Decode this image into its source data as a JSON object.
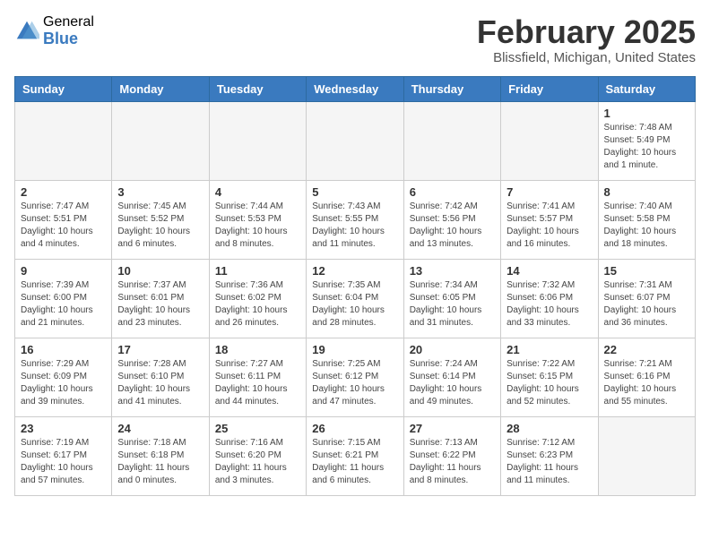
{
  "header": {
    "logo_general": "General",
    "logo_blue": "Blue",
    "month_year": "February 2025",
    "location": "Blissfield, Michigan, United States"
  },
  "days_of_week": [
    "Sunday",
    "Monday",
    "Tuesday",
    "Wednesday",
    "Thursday",
    "Friday",
    "Saturday"
  ],
  "weeks": [
    [
      {
        "day": "",
        "info": ""
      },
      {
        "day": "",
        "info": ""
      },
      {
        "day": "",
        "info": ""
      },
      {
        "day": "",
        "info": ""
      },
      {
        "day": "",
        "info": ""
      },
      {
        "day": "",
        "info": ""
      },
      {
        "day": "1",
        "info": "Sunrise: 7:48 AM\nSunset: 5:49 PM\nDaylight: 10 hours\nand 1 minute."
      }
    ],
    [
      {
        "day": "2",
        "info": "Sunrise: 7:47 AM\nSunset: 5:51 PM\nDaylight: 10 hours\nand 4 minutes."
      },
      {
        "day": "3",
        "info": "Sunrise: 7:45 AM\nSunset: 5:52 PM\nDaylight: 10 hours\nand 6 minutes."
      },
      {
        "day": "4",
        "info": "Sunrise: 7:44 AM\nSunset: 5:53 PM\nDaylight: 10 hours\nand 8 minutes."
      },
      {
        "day": "5",
        "info": "Sunrise: 7:43 AM\nSunset: 5:55 PM\nDaylight: 10 hours\nand 11 minutes."
      },
      {
        "day": "6",
        "info": "Sunrise: 7:42 AM\nSunset: 5:56 PM\nDaylight: 10 hours\nand 13 minutes."
      },
      {
        "day": "7",
        "info": "Sunrise: 7:41 AM\nSunset: 5:57 PM\nDaylight: 10 hours\nand 16 minutes."
      },
      {
        "day": "8",
        "info": "Sunrise: 7:40 AM\nSunset: 5:58 PM\nDaylight: 10 hours\nand 18 minutes."
      }
    ],
    [
      {
        "day": "9",
        "info": "Sunrise: 7:39 AM\nSunset: 6:00 PM\nDaylight: 10 hours\nand 21 minutes."
      },
      {
        "day": "10",
        "info": "Sunrise: 7:37 AM\nSunset: 6:01 PM\nDaylight: 10 hours\nand 23 minutes."
      },
      {
        "day": "11",
        "info": "Sunrise: 7:36 AM\nSunset: 6:02 PM\nDaylight: 10 hours\nand 26 minutes."
      },
      {
        "day": "12",
        "info": "Sunrise: 7:35 AM\nSunset: 6:04 PM\nDaylight: 10 hours\nand 28 minutes."
      },
      {
        "day": "13",
        "info": "Sunrise: 7:34 AM\nSunset: 6:05 PM\nDaylight: 10 hours\nand 31 minutes."
      },
      {
        "day": "14",
        "info": "Sunrise: 7:32 AM\nSunset: 6:06 PM\nDaylight: 10 hours\nand 33 minutes."
      },
      {
        "day": "15",
        "info": "Sunrise: 7:31 AM\nSunset: 6:07 PM\nDaylight: 10 hours\nand 36 minutes."
      }
    ],
    [
      {
        "day": "16",
        "info": "Sunrise: 7:29 AM\nSunset: 6:09 PM\nDaylight: 10 hours\nand 39 minutes."
      },
      {
        "day": "17",
        "info": "Sunrise: 7:28 AM\nSunset: 6:10 PM\nDaylight: 10 hours\nand 41 minutes."
      },
      {
        "day": "18",
        "info": "Sunrise: 7:27 AM\nSunset: 6:11 PM\nDaylight: 10 hours\nand 44 minutes."
      },
      {
        "day": "19",
        "info": "Sunrise: 7:25 AM\nSunset: 6:12 PM\nDaylight: 10 hours\nand 47 minutes."
      },
      {
        "day": "20",
        "info": "Sunrise: 7:24 AM\nSunset: 6:14 PM\nDaylight: 10 hours\nand 49 minutes."
      },
      {
        "day": "21",
        "info": "Sunrise: 7:22 AM\nSunset: 6:15 PM\nDaylight: 10 hours\nand 52 minutes."
      },
      {
        "day": "22",
        "info": "Sunrise: 7:21 AM\nSunset: 6:16 PM\nDaylight: 10 hours\nand 55 minutes."
      }
    ],
    [
      {
        "day": "23",
        "info": "Sunrise: 7:19 AM\nSunset: 6:17 PM\nDaylight: 10 hours\nand 57 minutes."
      },
      {
        "day": "24",
        "info": "Sunrise: 7:18 AM\nSunset: 6:18 PM\nDaylight: 11 hours\nand 0 minutes."
      },
      {
        "day": "25",
        "info": "Sunrise: 7:16 AM\nSunset: 6:20 PM\nDaylight: 11 hours\nand 3 minutes."
      },
      {
        "day": "26",
        "info": "Sunrise: 7:15 AM\nSunset: 6:21 PM\nDaylight: 11 hours\nand 6 minutes."
      },
      {
        "day": "27",
        "info": "Sunrise: 7:13 AM\nSunset: 6:22 PM\nDaylight: 11 hours\nand 8 minutes."
      },
      {
        "day": "28",
        "info": "Sunrise: 7:12 AM\nSunset: 6:23 PM\nDaylight: 11 hours\nand 11 minutes."
      },
      {
        "day": "",
        "info": ""
      }
    ]
  ]
}
